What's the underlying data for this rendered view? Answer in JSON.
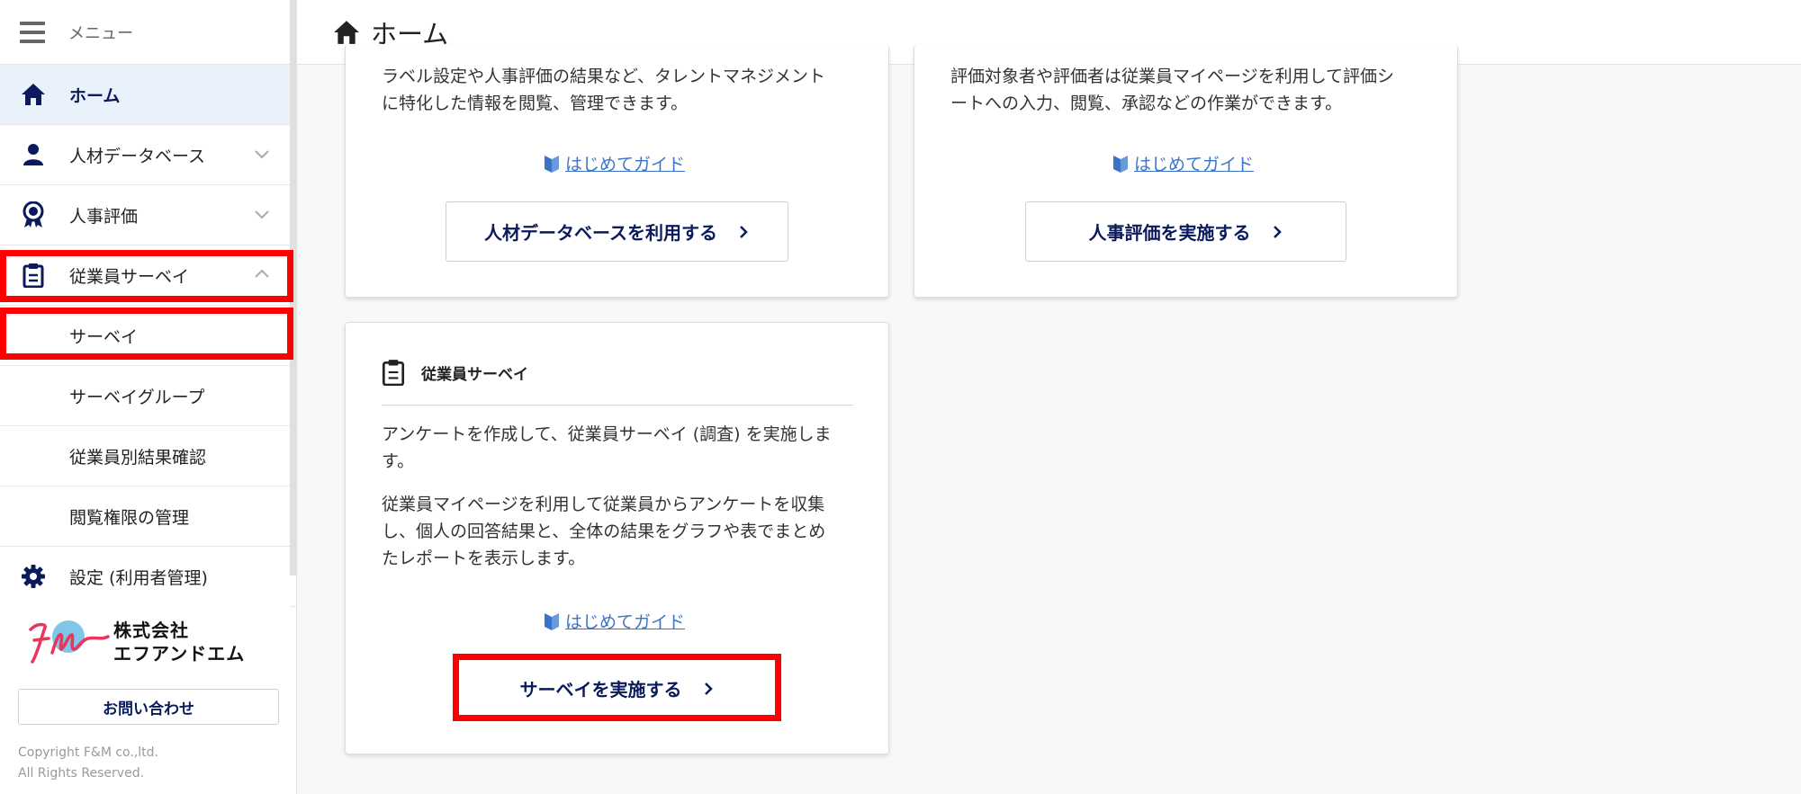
{
  "sidebar": {
    "menu_label": "メニュー",
    "items": [
      {
        "label": "ホーム"
      },
      {
        "label": "人材データベース"
      },
      {
        "label": "人事評価"
      },
      {
        "label": "従業員サーベイ"
      },
      {
        "label": "サーベイ"
      },
      {
        "label": "サーベイグループ"
      },
      {
        "label": "従業員別結果確認"
      },
      {
        "label": "閲覧権限の管理"
      },
      {
        "label": "設定 (利用者管理)"
      }
    ],
    "logo_line1": "株式会社",
    "logo_line2": "エフアンドエム",
    "contact_label": "お問い合わせ",
    "copyright_line1": "Copyright F&M co.,ltd.",
    "copyright_line2": "All Rights Reserved."
  },
  "header": {
    "title": "ホーム"
  },
  "cards": {
    "talent": {
      "line1": "ラベル設定や人事評価の結果など、タレントマネジメント",
      "line2": "に特化した情報を閲覧、管理できます。",
      "guide": "はじめてガイド",
      "button": "人材データベースを利用する"
    },
    "evaluation": {
      "line1": "評価対象者や評価者は従業員マイページを利用して評価シ",
      "line2": "ートへの入力、閲覧、承認などの作業ができます。",
      "guide": "はじめてガイド",
      "button": "人事評価を実施する"
    },
    "survey": {
      "title": "従業員サーベイ",
      "p1_line1": "アンケートを作成して、従業員サーベイ (調査) を実施しま",
      "p1_line2": "す。",
      "p2_line1": "従業員マイページを利用して従業員からアンケートを収集",
      "p2_line2": "し、個人の回答結果と、全体の結果をグラフや表でまとめ",
      "p2_line3": "たレポートを表示します。",
      "guide": "はじめてガイド",
      "button": "サーベイを実施する"
    }
  },
  "colors": {
    "highlight": "#ff0000",
    "navy": "#0a1a5c",
    "link": "#3b73c9",
    "active_bg": "#e9f1fb"
  }
}
